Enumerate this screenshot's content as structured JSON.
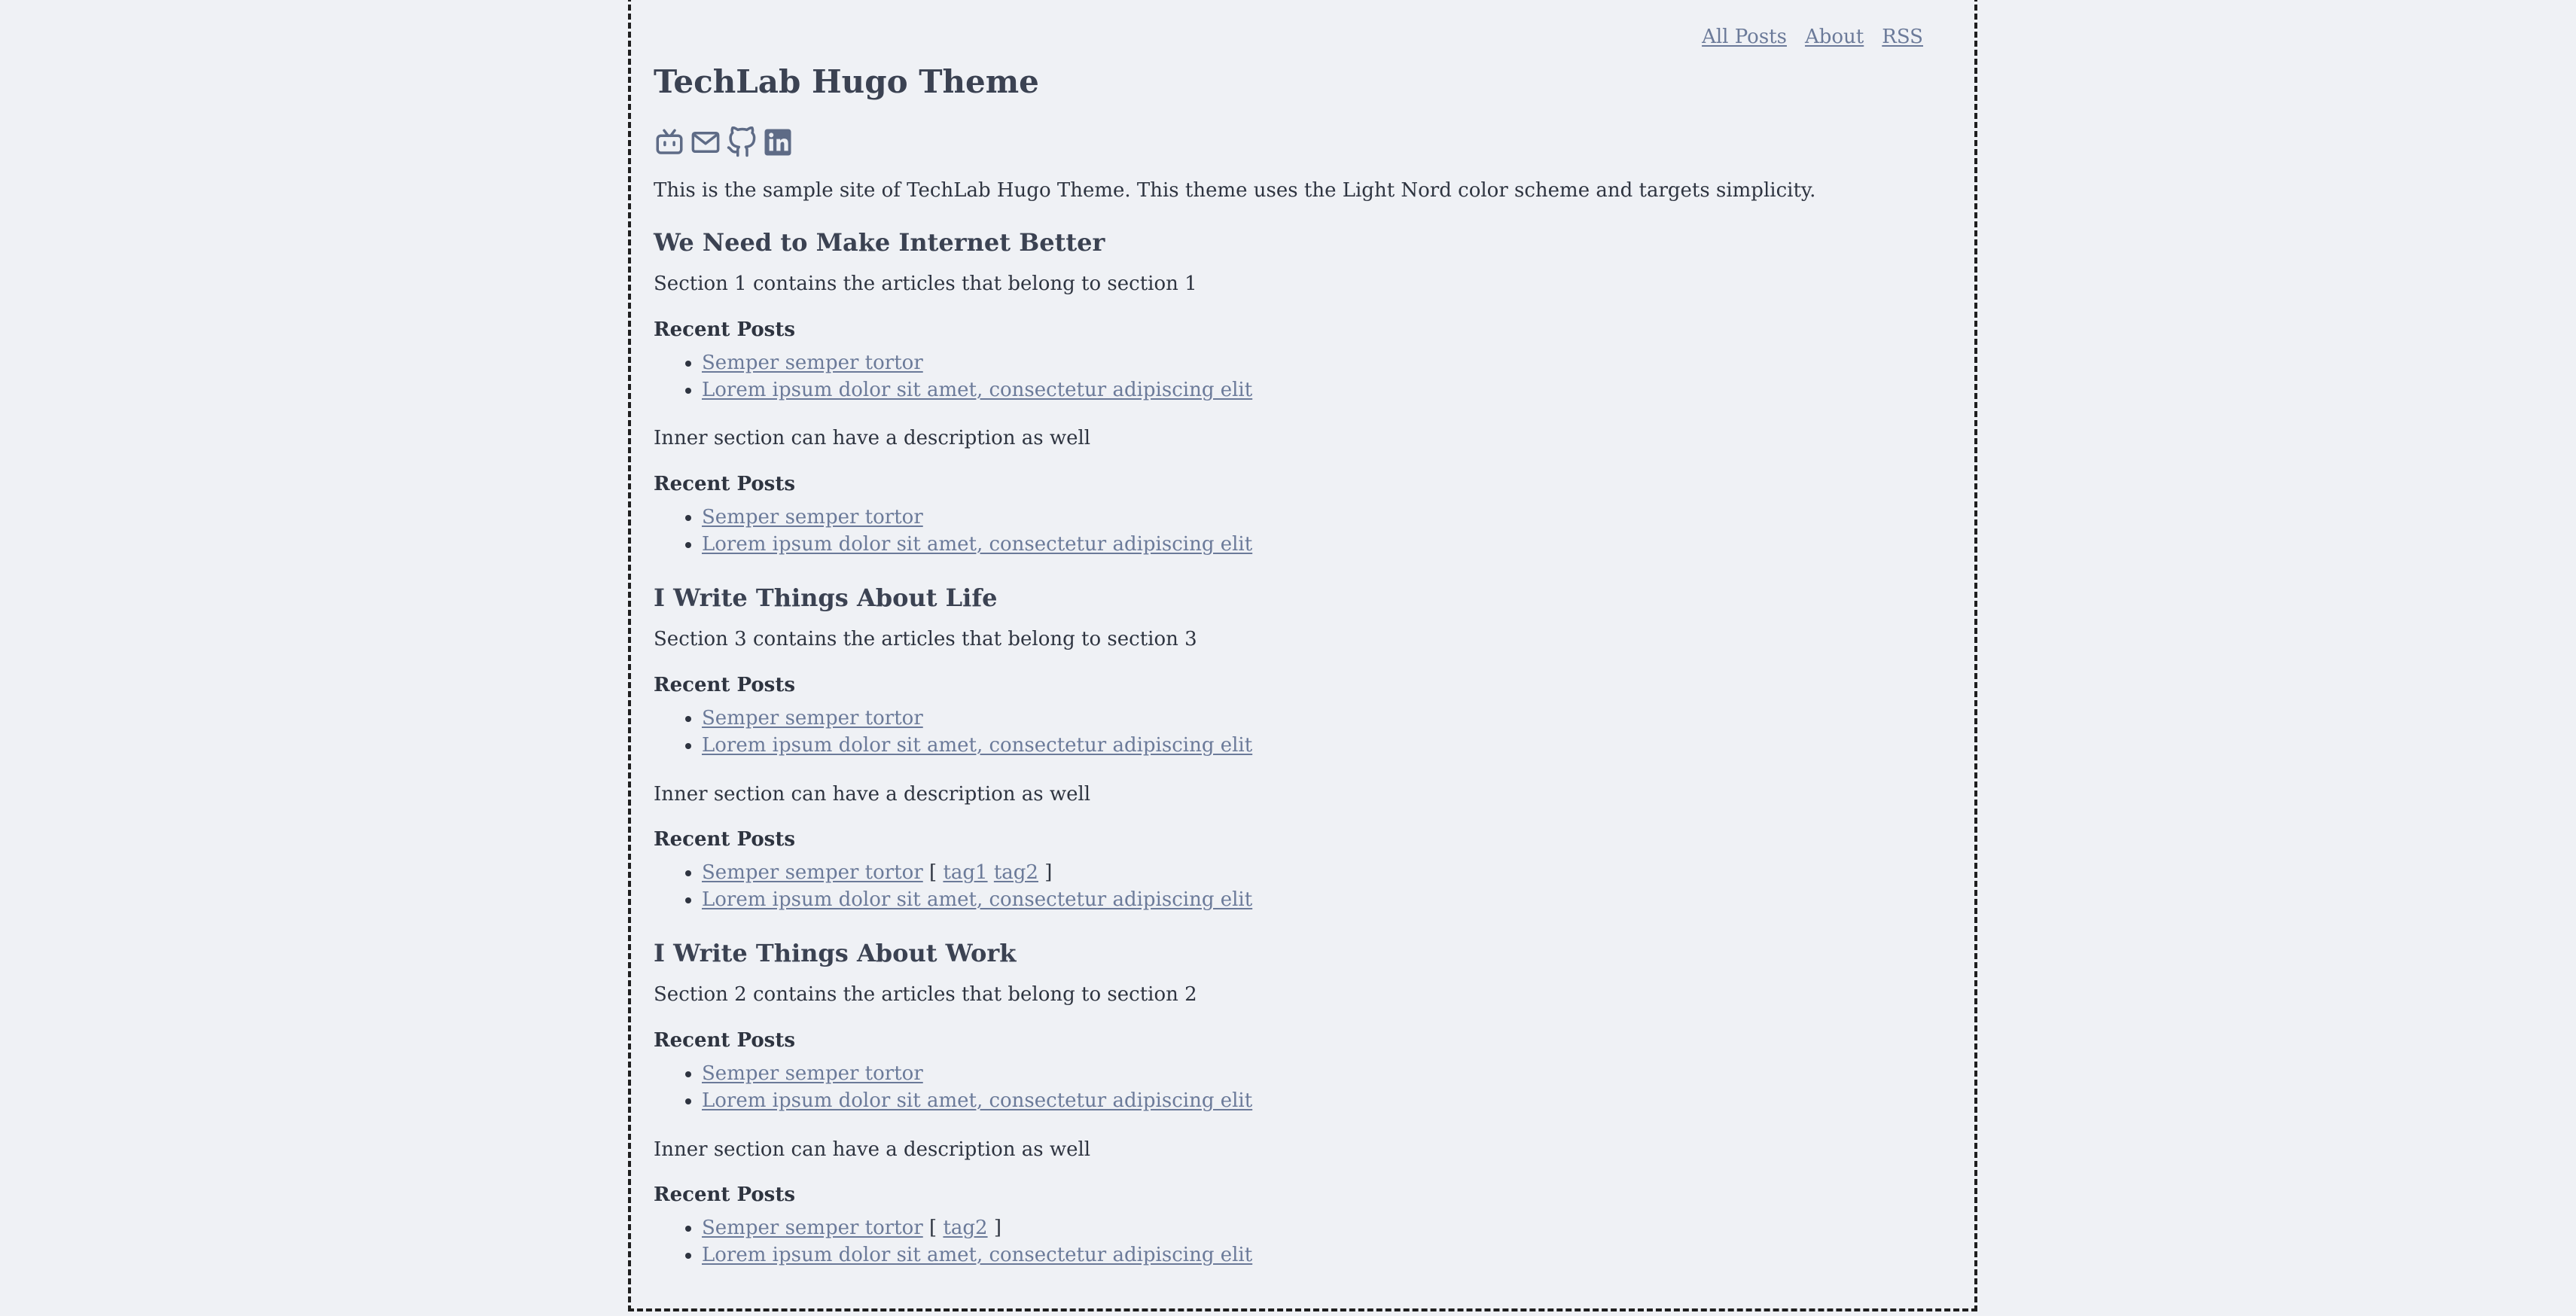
{
  "nav": {
    "all_posts": "All Posts",
    "about": "About",
    "rss": "RSS"
  },
  "site": {
    "title": "TechLab Hugo Theme",
    "intro": "This is the sample site of TechLab Hugo Theme. This theme uses the Light Nord color scheme and targets simplicity.",
    "social_icons": [
      "bilibili-icon",
      "mail-icon",
      "github-icon",
      "linkedin-icon"
    ]
  },
  "sections": [
    {
      "title": "We Need to Make Internet Better",
      "desc": "Section 1 contains the articles that belong to section 1",
      "recent_label": "Recent Posts",
      "posts": [
        "Semper semper tortor",
        "Lorem ipsum dolor sit amet, consectetur adipiscing elit"
      ],
      "inner_desc": "Inner section can have a description as well",
      "inner_recent_label": "Recent Posts",
      "inner_posts": [
        "Semper semper tortor",
        "Lorem ipsum dolor sit amet, consectetur adipiscing elit"
      ]
    },
    {
      "title": "I Write Things About Life",
      "desc": "Section 3 contains the articles that belong to section 3",
      "recent_label": "Recent Posts",
      "posts": [
        "Semper semper tortor",
        "Lorem ipsum dolor sit amet, consectetur adipiscing elit"
      ],
      "inner_desc": "Inner section can have a description as well",
      "inner_recent_label": "Recent Posts",
      "inner_posts": [
        "Semper semper tortor",
        "Lorem ipsum dolor sit amet, consectetur adipiscing elit"
      ],
      "inner_tags": [
        "tag1",
        "tag2"
      ]
    },
    {
      "title": "I Write Things About Work",
      "desc": "Section 2 contains the articles that belong to section 2",
      "recent_label": "Recent Posts",
      "posts": [
        "Semper semper tortor",
        "Lorem ipsum dolor sit amet, consectetur adipiscing elit"
      ],
      "inner_desc": "Inner section can have a description as well",
      "inner_recent_label": "Recent Posts",
      "inner_posts": [
        "Semper semper tortor",
        "Lorem ipsum dolor sit amet, consectetur adipiscing elit"
      ],
      "inner_tags": [
        "tag2"
      ]
    }
  ],
  "tag_brackets": {
    "open": "[",
    "close": "]"
  },
  "colors": {
    "background": "#eff1f5",
    "text": "#2e3440",
    "link": "#6b7a99",
    "icon": "#5e6b86"
  }
}
